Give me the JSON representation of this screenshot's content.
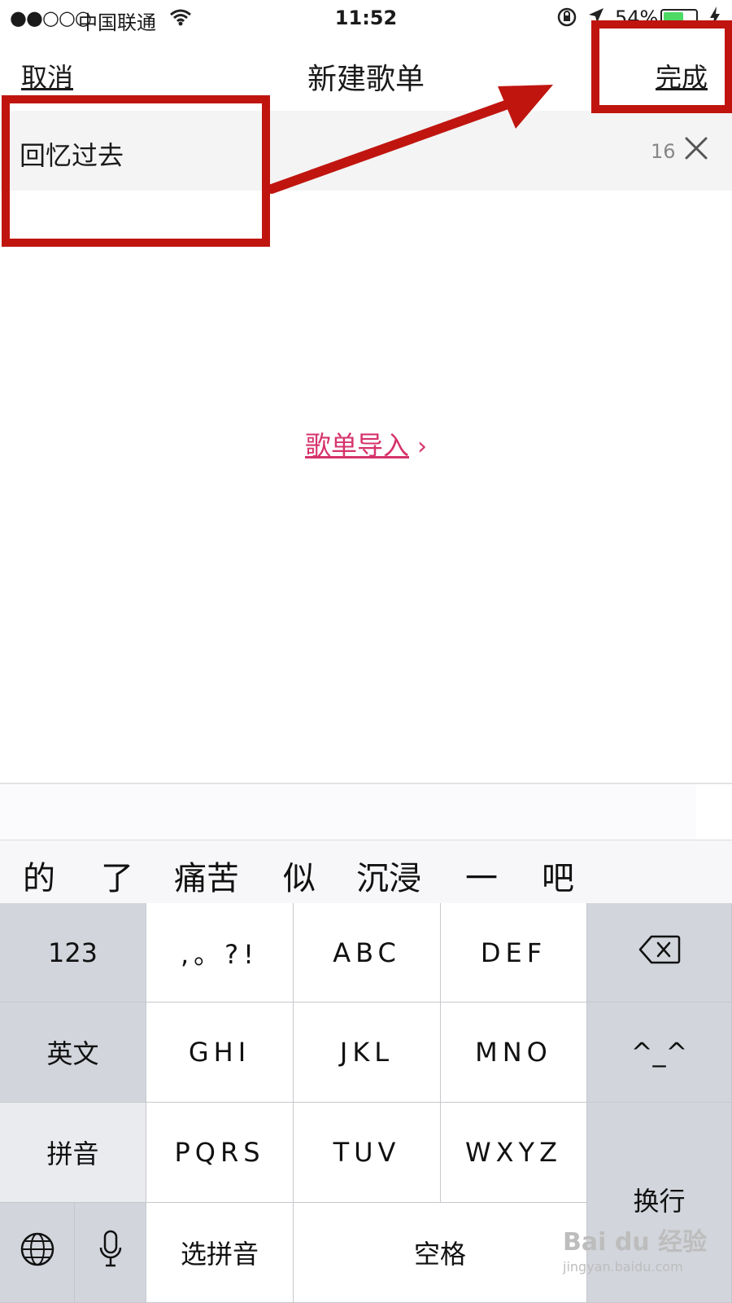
{
  "status_bar": {
    "signal": "●●○○○",
    "carrier": "中国联通",
    "time": "11:52",
    "battery_pct": "54%",
    "icons": [
      "wifi-icon",
      "rotation-lock-icon",
      "location-arrow-icon",
      "battery-icon",
      "charging-bolt-icon"
    ]
  },
  "nav": {
    "cancel": "取消",
    "title": "新建歌单",
    "done": "完成"
  },
  "name_field": {
    "value": "回忆过去",
    "counter": "16",
    "clear_icon": "close-icon"
  },
  "import_link": {
    "label": "歌单导入",
    "chevron": "›"
  },
  "candidates": [
    "的",
    "了",
    "痛苦",
    "似",
    "沉浸",
    "一",
    "吧"
  ],
  "keyboard": {
    "k123": "123",
    "punct": ",。?!",
    "abc": "ABC",
    "def": "DEF",
    "english": "英文",
    "ghi": "GHI",
    "jkl": "JKL",
    "mno": "MNO",
    "emoticon": "^_^",
    "pinyin": "拼音",
    "pqrs": "PQRS",
    "tuv": "TUV",
    "wxyz": "WXYZ",
    "return": "换行",
    "select_pinyin": "选拼音",
    "space": "空格",
    "icons": [
      "backspace-icon",
      "globe-icon",
      "microphone-icon"
    ]
  },
  "watermark": {
    "brand": "Bai du 经验",
    "url": "jingyan.baidu.com"
  },
  "colors": {
    "accent": "#d6336c",
    "annotation": "#c0150f",
    "keyboard_gray": "#d2d5db"
  }
}
